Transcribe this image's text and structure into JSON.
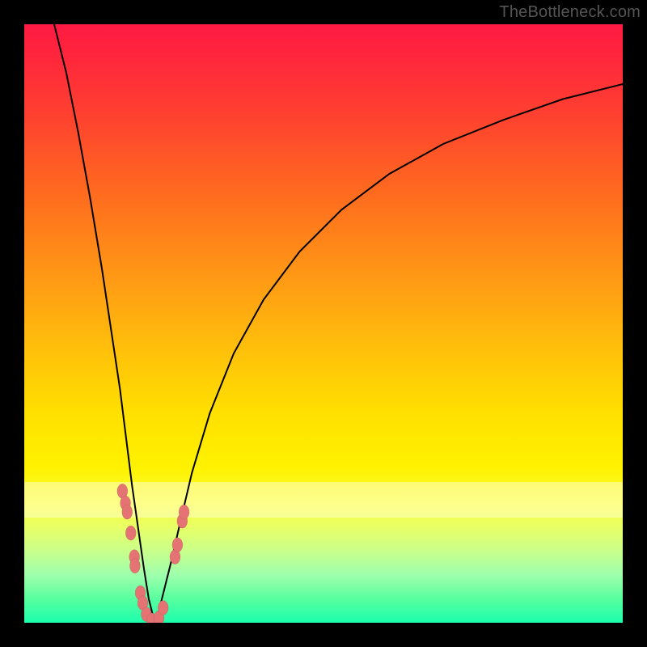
{
  "watermark": "TheBottleneck.com",
  "colors": {
    "frame": "#000000",
    "curve": "#000000",
    "marker": "#e57373",
    "gradient_top": "#ff1a44",
    "gradient_bottom": "#1cffad"
  },
  "chart_data": {
    "type": "line",
    "title": "",
    "xlabel": "",
    "ylabel": "",
    "xlim": [
      0,
      100
    ],
    "ylim": [
      0,
      100
    ],
    "description": "Two black curves on a vertical red→orange→yellow→green gradient background. Left curve descends steeply from upper-left, dipping to near-zero (the minimum/Bottleneck valley) around x≈21–22. Right curve rises from the same valley with decreasing slope toward upper-right. Pink dot markers cluster along both branches near the valley floor (roughly y 0–22).",
    "series": [
      {
        "name": "left-branch",
        "x": [
          5,
          7,
          9,
          11,
          13,
          14.5,
          16,
          17,
          18,
          19,
          20,
          20.8,
          21.5,
          22
        ],
        "y": [
          100,
          92,
          82,
          71,
          59,
          49,
          39,
          31,
          23,
          16,
          9,
          4,
          1.2,
          0
        ]
      },
      {
        "name": "right-branch",
        "x": [
          22,
          23,
          24.5,
          26,
          28,
          31,
          35,
          40,
          46,
          53,
          61,
          70,
          80,
          90,
          100
        ],
        "y": [
          0,
          4,
          10,
          16.5,
          25,
          35,
          45,
          54,
          62,
          69,
          75,
          80,
          84,
          87.5,
          90
        ]
      }
    ],
    "markers": {
      "name": "valley-markers",
      "points": [
        {
          "x": 16.4,
          "y": 22
        },
        {
          "x": 16.9,
          "y": 20
        },
        {
          "x": 17.2,
          "y": 18.5
        },
        {
          "x": 17.8,
          "y": 15
        },
        {
          "x": 18.4,
          "y": 11
        },
        {
          "x": 18.5,
          "y": 9.5
        },
        {
          "x": 19.4,
          "y": 5
        },
        {
          "x": 19.8,
          "y": 3.3
        },
        {
          "x": 20.4,
          "y": 1.4
        },
        {
          "x": 21.3,
          "y": 0.4
        },
        {
          "x": 22.5,
          "y": 0.8
        },
        {
          "x": 23.2,
          "y": 2.5
        },
        {
          "x": 25.2,
          "y": 11
        },
        {
          "x": 25.6,
          "y": 13
        },
        {
          "x": 26.4,
          "y": 17
        },
        {
          "x": 26.7,
          "y": 18.5
        }
      ]
    }
  }
}
